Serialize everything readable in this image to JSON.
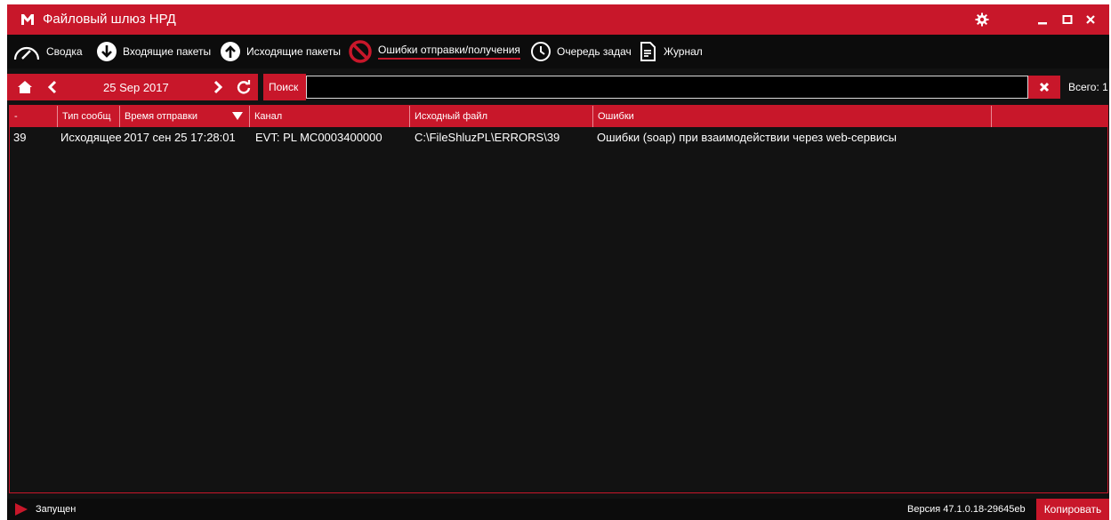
{
  "window": {
    "title": "Файловый шлюз НРД"
  },
  "colors": {
    "accent": "#c8172a",
    "background": "#121212",
    "text": "#ffffff"
  },
  "titlebar_icons": [
    "logo-icon",
    "gear-icon",
    "minimize-icon",
    "maximize-icon",
    "close-icon"
  ],
  "nav": {
    "items": [
      {
        "label": "Сводка",
        "icon": "gauge-icon"
      },
      {
        "label": "Входящие пакеты",
        "icon": "arrow-down-circle-icon"
      },
      {
        "label": "Исходящие пакеты",
        "icon": "arrow-up-circle-icon"
      },
      {
        "label": "Ошибки отправки/получения",
        "icon": "prohibited-icon",
        "active": true
      },
      {
        "label": "Очередь задач",
        "icon": "clock-icon"
      },
      {
        "label": "Журнал",
        "icon": "document-icon"
      }
    ]
  },
  "toolbar": {
    "date": "25 Sep 2017",
    "search_label": "Поиск",
    "search_value": "",
    "total": "Всего: 1"
  },
  "table": {
    "columns": [
      "-",
      "Тип сообщ",
      "Время отправки",
      "Канал",
      "Исходный файл",
      "Ошибки",
      ""
    ],
    "sort_column": "Время отправки",
    "sort_direction": "desc",
    "rows": [
      {
        "id": "39",
        "type": "Исходящее",
        "time": "2017 сен 25 17:28:01",
        "channel": "EVT: PL MC0003400000",
        "file": "C:\\FileShluzPL\\ERRORS\\39",
        "errors": "Ошибки (soap) при взаимодействии через web-сервисы"
      }
    ]
  },
  "status": {
    "state": "Запущен",
    "version": "Версия 47.1.0.18-29645eb",
    "copy_label": "Копировать"
  }
}
